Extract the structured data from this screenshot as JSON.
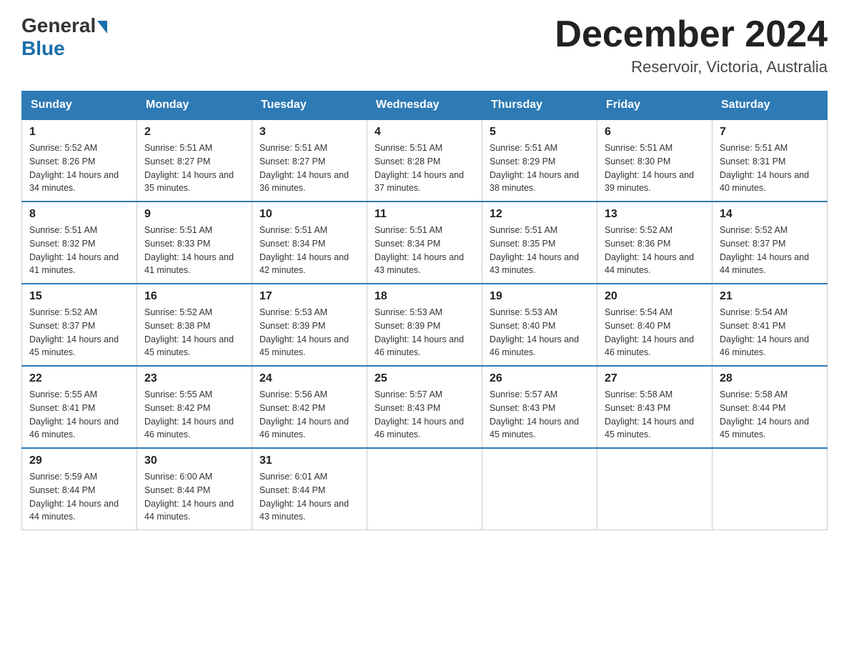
{
  "header": {
    "logo_general": "General",
    "logo_blue": "Blue",
    "month_title": "December 2024",
    "location": "Reservoir, Victoria, Australia"
  },
  "weekdays": [
    "Sunday",
    "Monday",
    "Tuesday",
    "Wednesday",
    "Thursday",
    "Friday",
    "Saturday"
  ],
  "weeks": [
    {
      "days": [
        {
          "num": "1",
          "sunrise": "5:52 AM",
          "sunset": "8:26 PM",
          "daylight": "14 hours and 34 minutes."
        },
        {
          "num": "2",
          "sunrise": "5:51 AM",
          "sunset": "8:27 PM",
          "daylight": "14 hours and 35 minutes."
        },
        {
          "num": "3",
          "sunrise": "5:51 AM",
          "sunset": "8:27 PM",
          "daylight": "14 hours and 36 minutes."
        },
        {
          "num": "4",
          "sunrise": "5:51 AM",
          "sunset": "8:28 PM",
          "daylight": "14 hours and 37 minutes."
        },
        {
          "num": "5",
          "sunrise": "5:51 AM",
          "sunset": "8:29 PM",
          "daylight": "14 hours and 38 minutes."
        },
        {
          "num": "6",
          "sunrise": "5:51 AM",
          "sunset": "8:30 PM",
          "daylight": "14 hours and 39 minutes."
        },
        {
          "num": "7",
          "sunrise": "5:51 AM",
          "sunset": "8:31 PM",
          "daylight": "14 hours and 40 minutes."
        }
      ]
    },
    {
      "days": [
        {
          "num": "8",
          "sunrise": "5:51 AM",
          "sunset": "8:32 PM",
          "daylight": "14 hours and 41 minutes."
        },
        {
          "num": "9",
          "sunrise": "5:51 AM",
          "sunset": "8:33 PM",
          "daylight": "14 hours and 41 minutes."
        },
        {
          "num": "10",
          "sunrise": "5:51 AM",
          "sunset": "8:34 PM",
          "daylight": "14 hours and 42 minutes."
        },
        {
          "num": "11",
          "sunrise": "5:51 AM",
          "sunset": "8:34 PM",
          "daylight": "14 hours and 43 minutes."
        },
        {
          "num": "12",
          "sunrise": "5:51 AM",
          "sunset": "8:35 PM",
          "daylight": "14 hours and 43 minutes."
        },
        {
          "num": "13",
          "sunrise": "5:52 AM",
          "sunset": "8:36 PM",
          "daylight": "14 hours and 44 minutes."
        },
        {
          "num": "14",
          "sunrise": "5:52 AM",
          "sunset": "8:37 PM",
          "daylight": "14 hours and 44 minutes."
        }
      ]
    },
    {
      "days": [
        {
          "num": "15",
          "sunrise": "5:52 AM",
          "sunset": "8:37 PM",
          "daylight": "14 hours and 45 minutes."
        },
        {
          "num": "16",
          "sunrise": "5:52 AM",
          "sunset": "8:38 PM",
          "daylight": "14 hours and 45 minutes."
        },
        {
          "num": "17",
          "sunrise": "5:53 AM",
          "sunset": "8:39 PM",
          "daylight": "14 hours and 45 minutes."
        },
        {
          "num": "18",
          "sunrise": "5:53 AM",
          "sunset": "8:39 PM",
          "daylight": "14 hours and 46 minutes."
        },
        {
          "num": "19",
          "sunrise": "5:53 AM",
          "sunset": "8:40 PM",
          "daylight": "14 hours and 46 minutes."
        },
        {
          "num": "20",
          "sunrise": "5:54 AM",
          "sunset": "8:40 PM",
          "daylight": "14 hours and 46 minutes."
        },
        {
          "num": "21",
          "sunrise": "5:54 AM",
          "sunset": "8:41 PM",
          "daylight": "14 hours and 46 minutes."
        }
      ]
    },
    {
      "days": [
        {
          "num": "22",
          "sunrise": "5:55 AM",
          "sunset": "8:41 PM",
          "daylight": "14 hours and 46 minutes."
        },
        {
          "num": "23",
          "sunrise": "5:55 AM",
          "sunset": "8:42 PM",
          "daylight": "14 hours and 46 minutes."
        },
        {
          "num": "24",
          "sunrise": "5:56 AM",
          "sunset": "8:42 PM",
          "daylight": "14 hours and 46 minutes."
        },
        {
          "num": "25",
          "sunrise": "5:57 AM",
          "sunset": "8:43 PM",
          "daylight": "14 hours and 46 minutes."
        },
        {
          "num": "26",
          "sunrise": "5:57 AM",
          "sunset": "8:43 PM",
          "daylight": "14 hours and 45 minutes."
        },
        {
          "num": "27",
          "sunrise": "5:58 AM",
          "sunset": "8:43 PM",
          "daylight": "14 hours and 45 minutes."
        },
        {
          "num": "28",
          "sunrise": "5:58 AM",
          "sunset": "8:44 PM",
          "daylight": "14 hours and 45 minutes."
        }
      ]
    },
    {
      "days": [
        {
          "num": "29",
          "sunrise": "5:59 AM",
          "sunset": "8:44 PM",
          "daylight": "14 hours and 44 minutes."
        },
        {
          "num": "30",
          "sunrise": "6:00 AM",
          "sunset": "8:44 PM",
          "daylight": "14 hours and 44 minutes."
        },
        {
          "num": "31",
          "sunrise": "6:01 AM",
          "sunset": "8:44 PM",
          "daylight": "14 hours and 43 minutes."
        },
        null,
        null,
        null,
        null
      ]
    }
  ],
  "labels": {
    "sunrise_prefix": "Sunrise: ",
    "sunset_prefix": "Sunset: ",
    "daylight_prefix": "Daylight: "
  }
}
